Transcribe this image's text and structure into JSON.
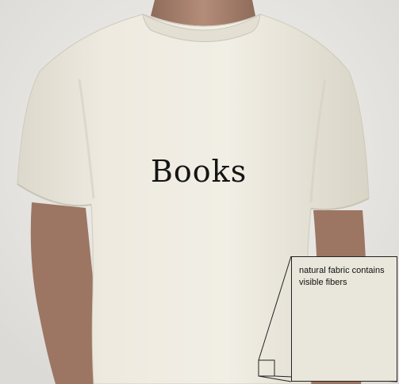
{
  "image": {
    "subject": "cream t-shirt on model",
    "colors": {
      "background": "#ebe9e6",
      "shirt": "#ece8dc",
      "skin": "#a7806d",
      "print": "#151515"
    }
  },
  "shirt_print": {
    "text": "Books"
  },
  "callout": {
    "text": "natural fabric contains visible fibers"
  }
}
